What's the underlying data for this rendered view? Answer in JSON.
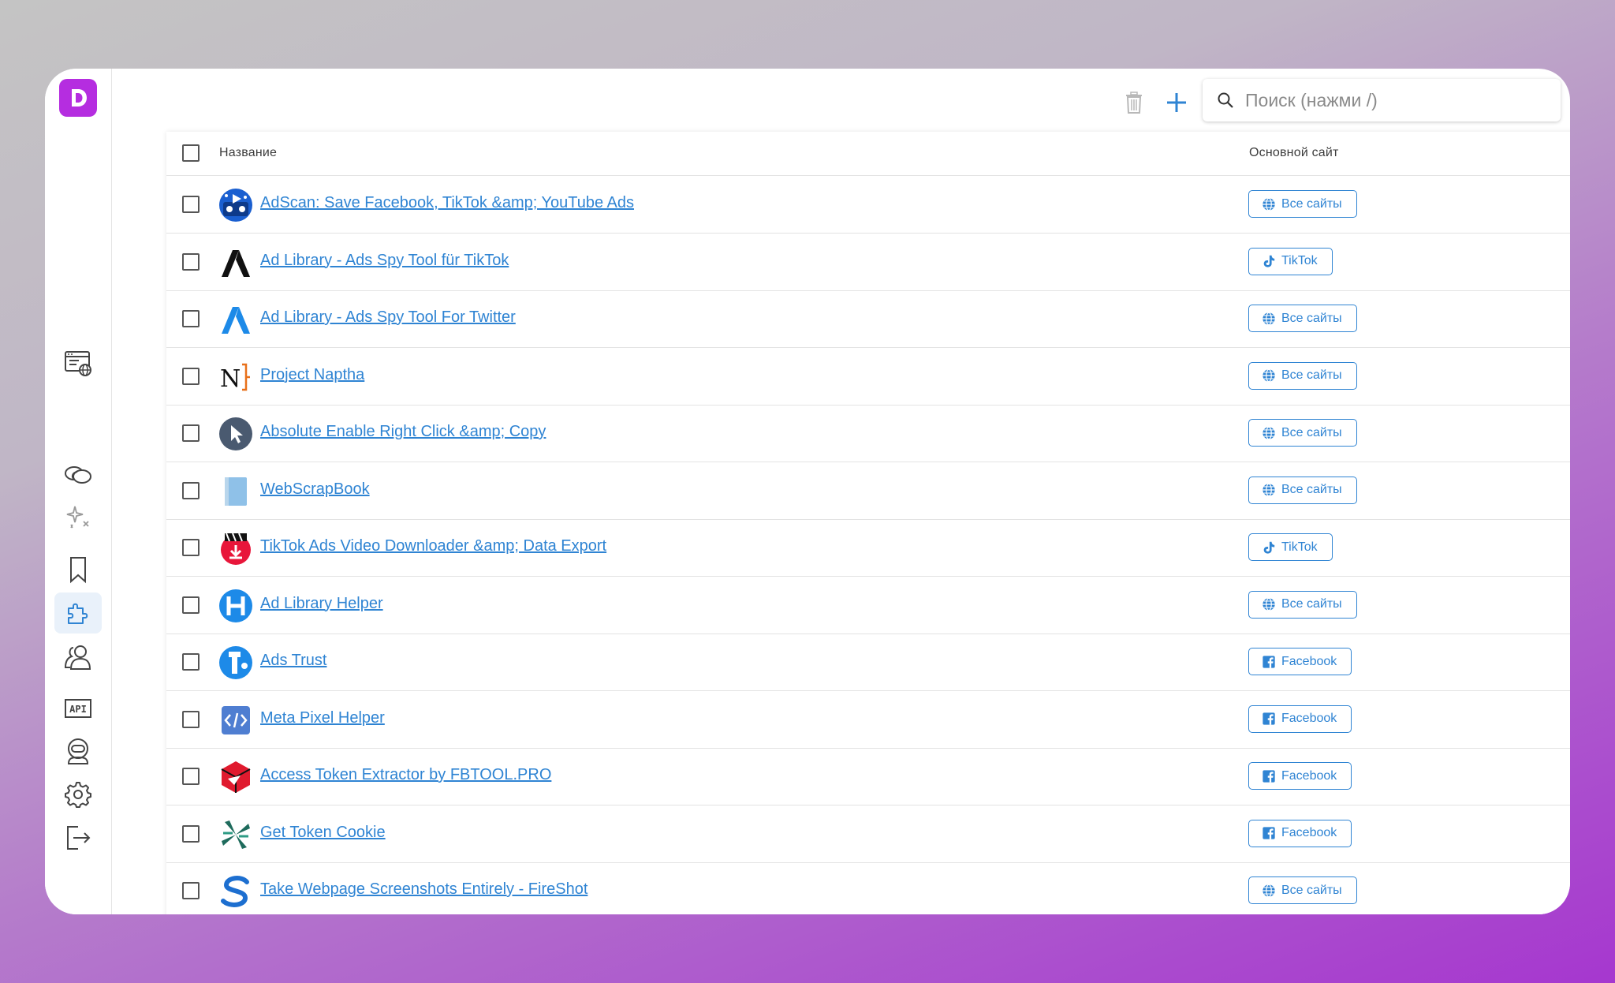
{
  "search": {
    "placeholder": "Поиск (нажми /)"
  },
  "table": {
    "col_name": "Название",
    "col_site": "Основной сайт"
  },
  "sidebar": {
    "logo_letter": "D",
    "items": [
      "browser-profiles-icon",
      "links-icon",
      "automation-sparkle-icon",
      "bookmark-icon",
      "extensions-icon",
      "team-icon",
      "api-icon",
      "bot-icon",
      "settings-icon",
      "logout-icon"
    ],
    "active": "extensions-icon",
    "api_label": "API"
  },
  "rows": [
    {
      "name": "AdScan: Save Facebook, TikTok &amp; YouTube Ads",
      "site": "Все сайты",
      "site_icon": "globe-icon",
      "icon": "adscan-icon"
    },
    {
      "name": "Ad Library - Ads Spy Tool für TikTok",
      "site": "TikTok",
      "site_icon": "tiktok-icon",
      "icon": "ad-library-black-icon"
    },
    {
      "name": "Ad Library - Ads Spy Tool For Twitter",
      "site": "Все сайты",
      "site_icon": "globe-icon",
      "icon": "ad-library-blue-icon"
    },
    {
      "name": "Project Naptha",
      "site": "Все сайты",
      "site_icon": "globe-icon",
      "icon": "naptha-icon"
    },
    {
      "name": "Absolute Enable Right Click &amp; Copy",
      "site": "Все сайты",
      "site_icon": "globe-icon",
      "icon": "cursor-icon"
    },
    {
      "name": "WebScrapBook",
      "site": "Все сайты",
      "site_icon": "globe-icon",
      "icon": "scrapbook-icon"
    },
    {
      "name": "TikTok Ads Video Downloader &amp; Data Export",
      "site": "TikTok",
      "site_icon": "tiktok-icon",
      "icon": "video-downloader-icon"
    },
    {
      "name": "Ad Library Helper",
      "site": "Все сайты",
      "site_icon": "globe-icon",
      "icon": "helper-h-icon"
    },
    {
      "name": "Ads Trust",
      "site": "Facebook",
      "site_icon": "facebook-icon",
      "icon": "ads-trust-icon"
    },
    {
      "name": "Meta Pixel Helper",
      "site": "Facebook",
      "site_icon": "facebook-icon",
      "icon": "code-icon"
    },
    {
      "name": "Access Token Extractor by FBTOOL.PRO",
      "site": "Facebook",
      "site_icon": "facebook-icon",
      "icon": "token-cube-icon"
    },
    {
      "name": "Get Token Cookie",
      "site": "Facebook",
      "site_icon": "facebook-icon",
      "icon": "pinwheel-icon"
    },
    {
      "name": "Take Webpage Screenshots Entirely - FireShot",
      "site": "Все сайты",
      "site_icon": "globe-icon",
      "icon": "fireshot-icon"
    }
  ],
  "colors": {
    "accent": "#2f84d3",
    "logo": "#b52de0",
    "active_nav_bg": "#e9f1fa"
  }
}
